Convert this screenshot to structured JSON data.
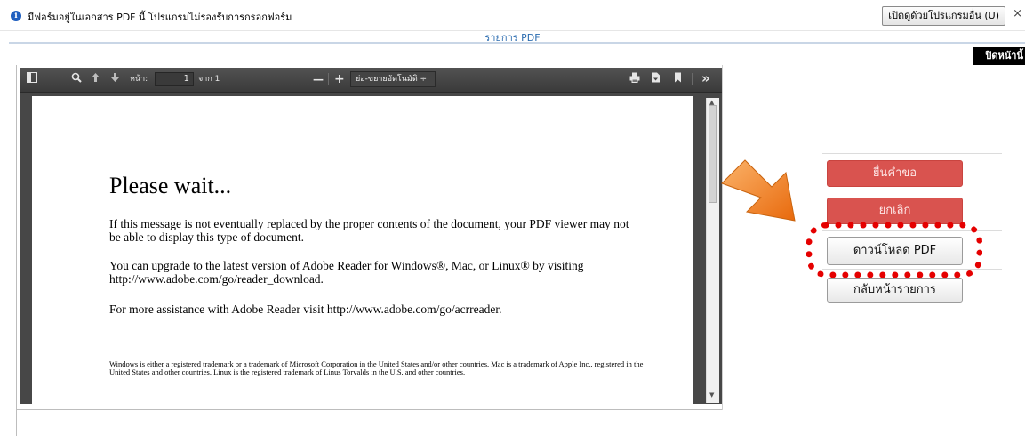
{
  "infobar": {
    "message": "มีฟอร์มอยู่ในเอกสาร PDF นี้ โปรแกรมไม่รองรับการกรอกฟอร์ม",
    "open_button": "เปิดดูด้วยโปรแกรมอื่น (U)",
    "close": "×"
  },
  "list_title": "รายการ PDF",
  "close_page": "ปิดหน้านี้",
  "viewer": {
    "page_label": "หน้า:",
    "page_value": "1",
    "page_total": "จาก 1",
    "zoom_minus": "—",
    "zoom_plus": "+",
    "zoom_value": "ย่อ-ขยายอัตโนมัติ  ÷",
    "more": "»"
  },
  "document": {
    "heading": "Please wait...",
    "para1": "If this message is not eventually replaced by the proper contents of the document, your PDF viewer may not be able to display this type of document.",
    "para2": "You can upgrade to the latest version of Adobe Reader for Windows®, Mac, or Linux® by visiting  http://www.adobe.com/go/reader_download.",
    "para3": "For more assistance with Adobe Reader visit  http://www.adobe.com/go/acrreader.",
    "fineprint": "Windows is either a registered trademark or a trademark of Microsoft Corporation in the United States and/or other countries. Mac is a trademark of Apple Inc., registered in the United States and other countries. Linux is the registered trademark of Linus Torvalds in the U.S. and other countries."
  },
  "actions": {
    "submit": "ยื่นคำขอ",
    "cancel": "ยกเลิก",
    "download": "ดาวน์โหลด PDF",
    "back": "กลับหน้ารายการ"
  },
  "colors": {
    "danger": "#d9534f",
    "highlight": "#e50000",
    "arrow": "#f07b1e"
  }
}
